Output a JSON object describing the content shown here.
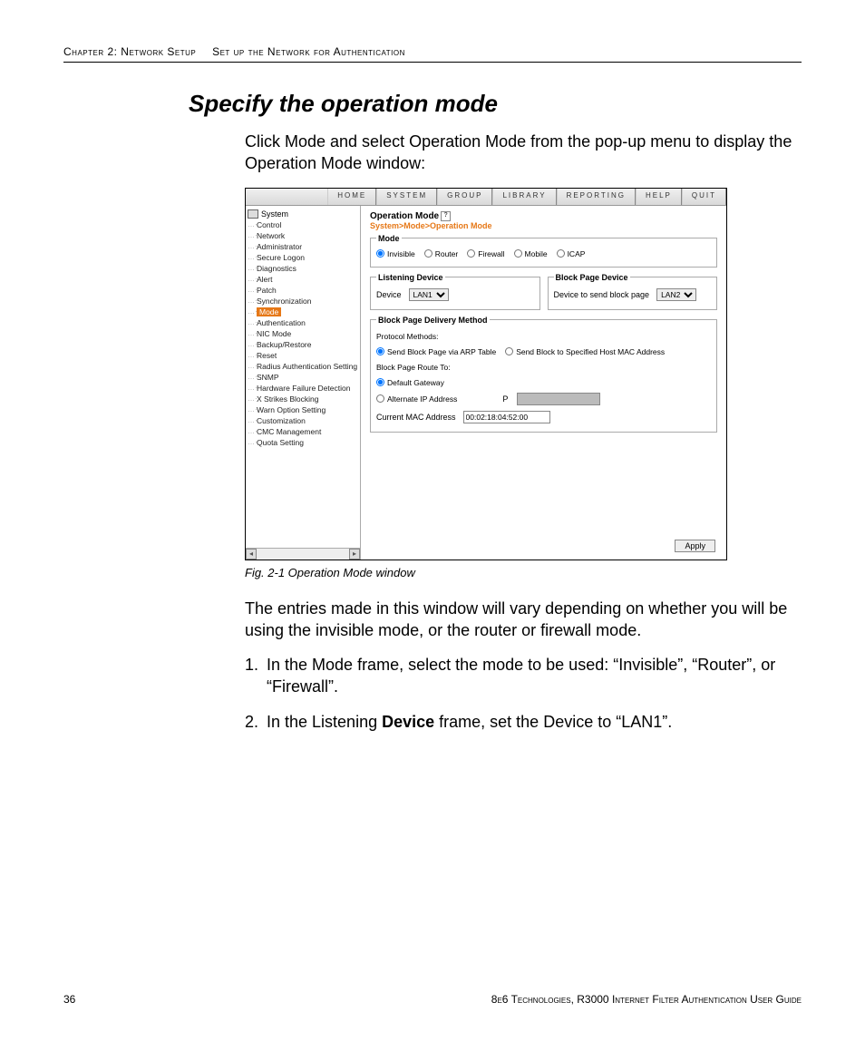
{
  "header": {
    "chapter": "Chapter 2: Network Setup",
    "section": "Set up the Network for Authentication"
  },
  "title": "Specify the operation mode",
  "intro": "Click Mode and select Operation Mode from the pop-up menu to display the Operation Mode window:",
  "screenshot": {
    "menubar": [
      "HOME",
      "SYSTEM",
      "GROUP",
      "LIBRARY",
      "REPORTING",
      "HELP",
      "QUIT"
    ],
    "tree_root": "System",
    "tree_items": [
      {
        "label": "Control"
      },
      {
        "label": "Network"
      },
      {
        "label": "Administrator"
      },
      {
        "label": "Secure Logon"
      },
      {
        "label": "Diagnostics"
      },
      {
        "label": "Alert"
      },
      {
        "label": "Patch"
      },
      {
        "label": "Synchronization"
      },
      {
        "label": "Mode",
        "selected": true
      },
      {
        "label": "Authentication"
      },
      {
        "label": "NIC Mode"
      },
      {
        "label": "Backup/Restore"
      },
      {
        "label": "Reset"
      },
      {
        "label": "Radius Authentication Setting"
      },
      {
        "label": "SNMP"
      },
      {
        "label": "Hardware Failure Detection"
      },
      {
        "label": "X Strikes Blocking"
      },
      {
        "label": "Warn Option Setting"
      },
      {
        "label": "Customization"
      },
      {
        "label": "CMC Management"
      },
      {
        "label": "Quota Setting"
      }
    ],
    "panel": {
      "title": "Operation Mode",
      "breadcrumb": "System>Mode>Operation Mode",
      "mode_legend": "Mode",
      "mode_options": [
        "Invisible",
        "Router",
        "Firewall",
        "Mobile",
        "ICAP"
      ],
      "mode_selected": "Invisible",
      "listening_legend": "Listening Device",
      "listening_label": "Device",
      "listening_value": "LAN1",
      "blockdev_legend": "Block Page Device",
      "blockdev_label": "Device to send block page",
      "blockdev_value": "LAN2",
      "delivery_legend": "Block Page Delivery Method",
      "protocol_label": "Protocol Methods:",
      "protocol_options": [
        "Send Block Page via ARP Table",
        "Send Block to Specified Host MAC Address"
      ],
      "protocol_selected": "Send Block Page via ARP Table",
      "route_label": "Block Page Route To:",
      "route_options": [
        "Default Gateway",
        "Alternate IP Address"
      ],
      "route_selected": "Default Gateway",
      "ip_label": "P",
      "mac_label": "Current MAC Address",
      "mac_value": "00:02:18:04:52:00",
      "apply": "Apply"
    }
  },
  "caption": "Fig. 2-1  Operation Mode window",
  "para2": "The entries made in this window will vary depending on whether you will be using the invisible mode, or the router or firewall mode.",
  "steps": [
    "In the Mode frame, select the mode to be used: “Invisible”, “Router”, or “Firewall”.",
    "In the Listening Device frame, set the Device to “LAN1”."
  ],
  "step2_bold": "Device",
  "footer": {
    "page": "36",
    "right": "8e6 Technologies, R3000 Internet Filter Authentication User Guide"
  }
}
